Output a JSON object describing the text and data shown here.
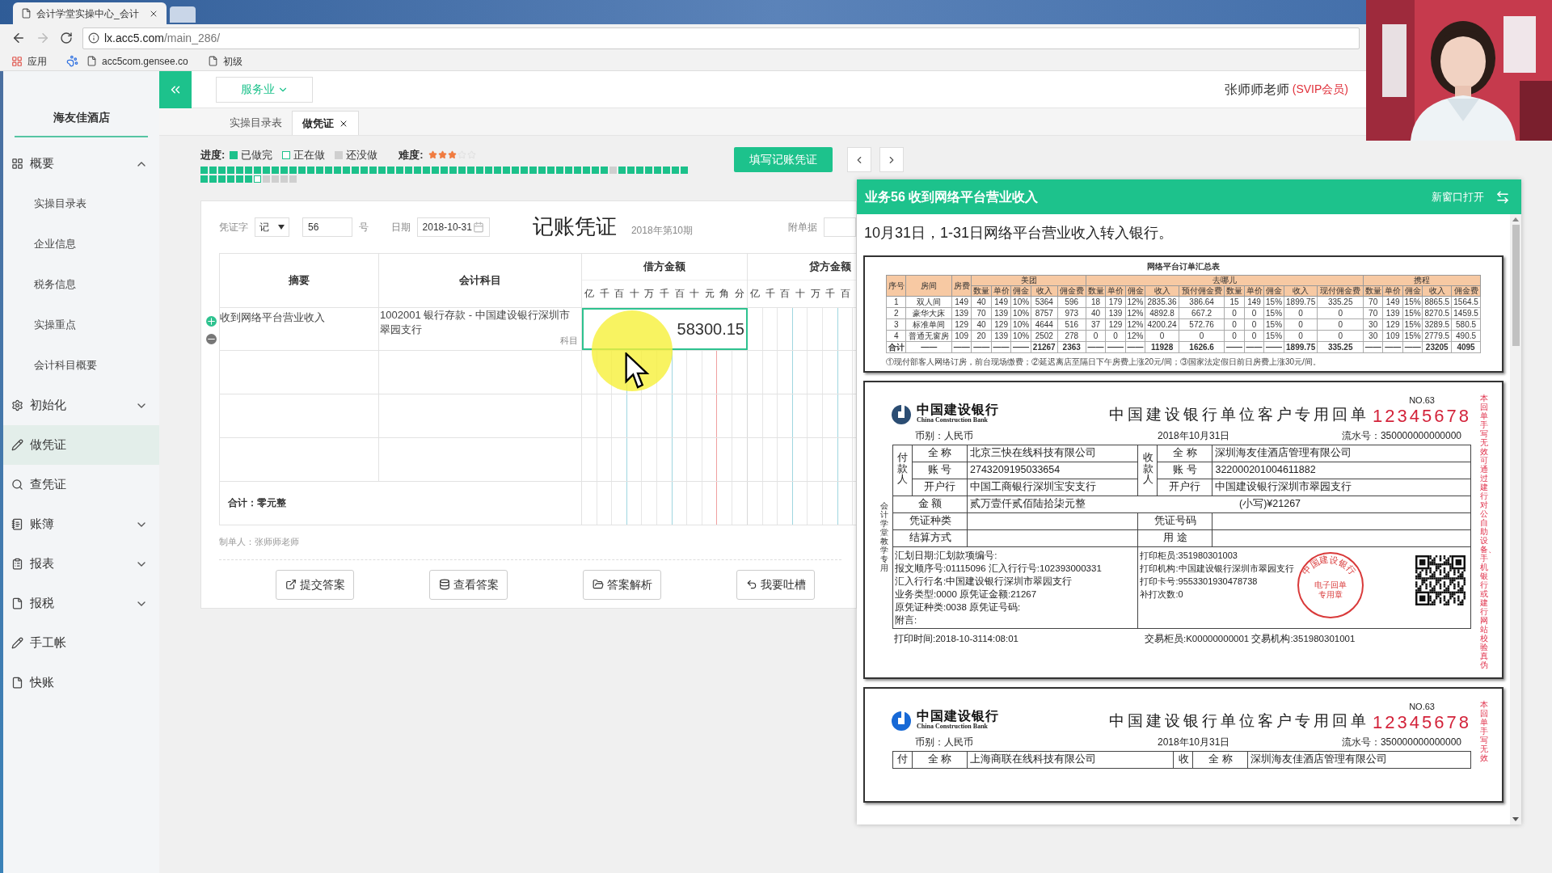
{
  "browser": {
    "tab_title": "会计学堂实操中心_会计",
    "url_host": "lx.acc5.com",
    "url_path": "/main_286/",
    "bookmarks": [
      {
        "kind": "apps",
        "label": "应用"
      },
      {
        "kind": "paw"
      },
      {
        "kind": "page",
        "label": "acc5com.gensee.co"
      },
      {
        "kind": "page",
        "label": "初级"
      }
    ]
  },
  "sidebar": {
    "company": "海友佳酒店",
    "items": [
      {
        "label": "概要",
        "kind": "group",
        "expanded": true,
        "selected": false,
        "children": [
          {
            "label": "实操目录表",
            "selected": false
          },
          {
            "label": "企业信息",
            "selected": false
          },
          {
            "label": "税务信息",
            "selected": false
          },
          {
            "label": "实操重点",
            "selected": false
          },
          {
            "label": "会计科目概要",
            "selected": false
          }
        ]
      },
      {
        "label": "初始化",
        "kind": "group",
        "expanded": false,
        "selected": false
      },
      {
        "label": "做凭证",
        "kind": "link",
        "selected": true
      },
      {
        "label": "查凭证",
        "kind": "link",
        "selected": false
      },
      {
        "label": "账簿",
        "kind": "group",
        "expanded": false,
        "selected": false
      },
      {
        "label": "报表",
        "kind": "group",
        "expanded": false,
        "selected": false
      },
      {
        "label": "报税",
        "kind": "group",
        "expanded": false,
        "selected": false
      },
      {
        "label": "手工帐",
        "kind": "link",
        "selected": false
      },
      {
        "label": "快账",
        "kind": "link",
        "selected": false
      }
    ]
  },
  "header": {
    "industry": "服务业",
    "user_name": "张师师老师",
    "user_badge": "(SVIP会员)"
  },
  "tabs": [
    {
      "label": "实操目录表",
      "selected": false,
      "closable": false
    },
    {
      "label": "做凭证",
      "selected": true,
      "closable": true
    }
  ],
  "progress": {
    "label": "进度:",
    "legend": [
      {
        "label": "已做完",
        "kind": "done"
      },
      {
        "label": "正在做",
        "kind": "current"
      },
      {
        "label": "还没做",
        "kind": "todo"
      }
    ],
    "difficulty_label": "难度:",
    "stars": 3,
    "cells": [
      {
        "kind": "done"
      },
      {
        "kind": "done"
      },
      {
        "kind": "done"
      },
      {
        "kind": "done"
      },
      {
        "kind": "done"
      },
      {
        "kind": "done"
      },
      {
        "kind": "done"
      },
      {
        "kind": "done"
      },
      {
        "kind": "done"
      },
      {
        "kind": "done"
      },
      {
        "kind": "done"
      },
      {
        "kind": "done"
      },
      {
        "kind": "done"
      },
      {
        "kind": "done"
      },
      {
        "kind": "done"
      },
      {
        "kind": "done"
      },
      {
        "kind": "done"
      },
      {
        "kind": "done"
      },
      {
        "kind": "done"
      },
      {
        "kind": "done"
      },
      {
        "kind": "done"
      },
      {
        "kind": "done"
      },
      {
        "kind": "done"
      },
      {
        "kind": "done"
      },
      {
        "kind": "done"
      },
      {
        "kind": "done"
      },
      {
        "kind": "done"
      },
      {
        "kind": "done"
      },
      {
        "kind": "done"
      },
      {
        "kind": "done"
      },
      {
        "kind": "done"
      },
      {
        "kind": "done"
      },
      {
        "kind": "done"
      },
      {
        "kind": "done"
      },
      {
        "kind": "done"
      },
      {
        "kind": "done"
      },
      {
        "kind": "done"
      },
      {
        "kind": "done"
      },
      {
        "kind": "done"
      },
      {
        "kind": "done"
      },
      {
        "kind": "done"
      },
      {
        "kind": "done"
      },
      {
        "kind": "done"
      },
      {
        "kind": "done"
      },
      {
        "kind": "done"
      },
      {
        "kind": "done"
      },
      {
        "kind": "todo"
      },
      {
        "kind": "done"
      },
      {
        "kind": "done"
      },
      {
        "kind": "done"
      },
      {
        "kind": "done"
      },
      {
        "kind": "done"
      },
      {
        "kind": "done"
      },
      {
        "kind": "done"
      },
      {
        "kind": "done"
      },
      {
        "kind": "done"
      },
      {
        "kind": "done"
      },
      {
        "kind": "done"
      },
      {
        "kind": "done"
      },
      {
        "kind": "done"
      },
      {
        "kind": "done"
      },
      {
        "kind": "current"
      },
      {
        "kind": "todo"
      },
      {
        "kind": "todo"
      },
      {
        "kind": "todo"
      },
      {
        "kind": "todo"
      }
    ]
  },
  "fill_voucher_button": "填写记账凭证",
  "voucher": {
    "word_label": "凭证字",
    "word": "记",
    "number": "56",
    "number_suffix": "号",
    "date_label": "日期",
    "date": "2018-10-31",
    "title": "记账凭证",
    "period": "2018年第10期",
    "attachments_label": "附单据",
    "columns": {
      "summary": "摘要",
      "account": "会计科目",
      "debit": "借方金额",
      "credit": "贷方金额"
    },
    "debit_digits": [
      "亿",
      "千",
      "百",
      "十",
      "万",
      "千",
      "百",
      "十",
      "元",
      "角",
      "分"
    ],
    "credit_digits": [
      "亿",
      "千",
      "百",
      "十",
      "万",
      "千",
      "百"
    ],
    "rows": [
      {
        "summary": "收到网络平台营业收入",
        "account": "1002001 银行存款 - 中国建设银行深圳市翠园支行",
        "account_hint": "科目",
        "debit": "58300.15",
        "editing": true
      }
    ],
    "total": "合计：零元整",
    "preparer": "制单人：张师师老师",
    "actions": [
      "提交答案",
      "查看答案",
      "答案解析",
      "我要吐槽"
    ]
  },
  "task_panel": {
    "title": "业务56 收到网络平台营业收入",
    "open_new": "新窗口打开",
    "description": "10月31日，1-31日网络平台营业收入转入银行。",
    "order_summary": {
      "title": "网络平台订单汇总表",
      "fixed_columns": [
        "序号",
        "房间",
        "房费"
      ],
      "groups": [
        {
          "label": "美团",
          "columns": [
            "数量",
            "单价",
            "佣金",
            "收入",
            "佣金费"
          ]
        },
        {
          "label": "去哪儿",
          "columns": [
            "数量",
            "单价",
            "佣金",
            "收入",
            "预付佣金费",
            "数量",
            "单价",
            "佣金",
            "收入",
            "现付佣金费"
          ]
        },
        {
          "label": "携程",
          "columns": [
            "数量",
            "单价",
            "佣金",
            "收入",
            "佣金费"
          ]
        }
      ],
      "rows": [
        [
          "1",
          "双人间",
          "149",
          "40",
          "149",
          "10%",
          "5364",
          "596",
          "18",
          "179",
          "12%",
          "2835.36",
          "386.64",
          "15",
          "149",
          "15%",
          "1899.75",
          "335.25",
          "70",
          "149",
          "15%",
          "8865.5",
          "1564.5"
        ],
        [
          "2",
          "豪华大床",
          "139",
          "70",
          "139",
          "10%",
          "8757",
          "973",
          "40",
          "139",
          "12%",
          "4892.8",
          "667.2",
          "0",
          "0",
          "15%",
          "0",
          "0",
          "70",
          "139",
          "15%",
          "8270.5",
          "1459.5"
        ],
        [
          "3",
          "标准单间",
          "129",
          "40",
          "129",
          "10%",
          "4644",
          "516",
          "37",
          "129",
          "12%",
          "4200.24",
          "572.76",
          "0",
          "0",
          "15%",
          "0",
          "0",
          "30",
          "129",
          "15%",
          "3289.5",
          "580.5"
        ],
        [
          "4",
          "普通无窗房",
          "109",
          "20",
          "139",
          "10%",
          "2502",
          "278",
          "0",
          "0",
          "12%",
          "0",
          "0",
          "0",
          "0",
          "15%",
          "0",
          "0",
          "30",
          "109",
          "15%",
          "2779.5",
          "490.5"
        ],
        [
          "合计",
          "——",
          "——",
          "——",
          "——",
          "——",
          "21267",
          "2363",
          "——",
          "——",
          "——",
          "11928",
          "1626.6",
          "——",
          "——",
          "——",
          "1899.75",
          "335.25",
          "——",
          "——",
          "——",
          "23205",
          "4095"
        ]
      ],
      "footnote": "①现付部客人网络订房，前台现场缴费；②延迟离店至隔日下午房费上涨20元/间；③国家法定假日前日房费上涨30元/间。"
    },
    "receipts": [
      {
        "bank_name": "中国建设银行",
        "bank_name_en": "China Construction Bank",
        "title": "中国建设银行单位客户专用回单",
        "no": "NO.63",
        "serial": "12345678",
        "currency": "币别：人民币",
        "date": "2018年10月31日",
        "flow_no": "流水号：350000000000000",
        "side_stamp": "会计学堂教学专用",
        "side_note": "本回单手写无效可通过建行对公自助设备、手机银行或建行网站校验真伪",
        "payer_label": "付款人",
        "payee_label": "收款人",
        "payer": {
          "name_label": "全 称",
          "name": "北京三快在线科技有限公司",
          "account_label": "账 号",
          "account": "2743209195033654",
          "bank_label": "开户行",
          "bank": "中国工商银行深圳宝安支行"
        },
        "payee": {
          "name_label": "全 称",
          "name": "深圳海友佳酒店管理有限公司",
          "account_label": "账 号",
          "account": "322000201004611882",
          "bank_label": "开户行",
          "bank": "中国建设银行深圳市翠园支行"
        },
        "amount_label": "金 额",
        "amount_words": "贰万壹仟贰佰陆拾柒元整",
        "amount_figure": "(小写)¥21267",
        "voucher_type_label": "凭证种类",
        "voucher_no_label": "凭证号码",
        "settle_label": "结算方式",
        "purpose_label": "用 途",
        "details_left": [
          "汇划日期:汇划款项编号:",
          "报文顺序号:01115096 汇入行行号:102393000331",
          "汇入行行名:中国建设银行深圳市翠园支行",
          "业务类型:0000 原凭证金额:21267",
          "原凭证种类:0038 原凭证号码:",
          "附言:"
        ],
        "details_right": [
          "打印柜员:351980301003",
          "打印机构:中国建设银行深圳市翠园支行",
          "打印卡号:9553301930478738",
          "补打次数:0"
        ],
        "seal": {
          "ring": "中国建设银行",
          "lines": [
            "电子回单",
            "专用章"
          ]
        },
        "print_time": "打印时间:2018-10-3114:08:01",
        "teller": "交易柜员:K00000000001 交易机构:351980301001"
      },
      {
        "bank_name": "中国建设银行",
        "bank_name_en": "China Construction Bank",
        "title": "中国建设银行单位客户专用回单",
        "no": "NO.63",
        "serial": "12345678",
        "currency": "币别：人民币",
        "date": "2018年10月31日",
        "flow_no": "流水号：350000000000000",
        "side_note": "本回单手写无效",
        "payer_label": "付",
        "payee_label": "收",
        "payer": {
          "name_label": "全 称",
          "name": "上海商联在线科技有限公司"
        },
        "payee": {
          "name_label": "全 称",
          "name": "深圳海友佳酒店管理有限公司"
        }
      }
    ]
  }
}
